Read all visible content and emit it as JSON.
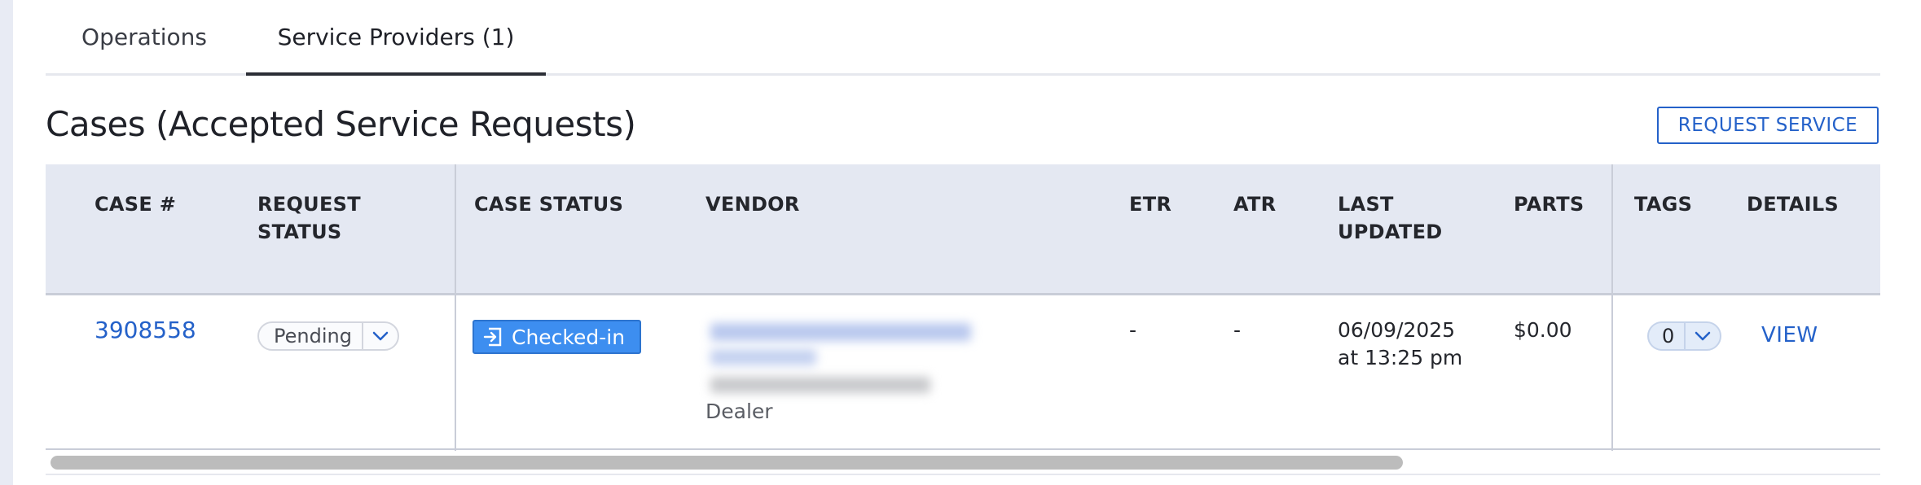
{
  "tabs": [
    {
      "label": "Operations"
    },
    {
      "label": "Service Providers (1)"
    }
  ],
  "header": {
    "title": "Cases (Accepted Service Requests)",
    "request_button": "REQUEST SERVICE"
  },
  "table": {
    "columns": {
      "case": "CASE #",
      "request_status": "REQUEST STATUS",
      "case_status": "CASE STATUS",
      "vendor": "VENDOR",
      "etr": "ETR",
      "atr": "ATR",
      "last_updated": "LAST UPDATED",
      "parts": "PARTS",
      "tags": "TAGS",
      "details": "DETAILS"
    },
    "rows": [
      {
        "case_number": "3908558",
        "request_status": "Pending",
        "case_status": "Checked-in",
        "vendor_type": "Dealer",
        "etr": "-",
        "atr": "-",
        "last_updated_date": "06/09/2025",
        "last_updated_time": "at 13:25 pm",
        "parts": "$0.00",
        "tags_count": "0",
        "details_link": "VIEW"
      }
    ]
  },
  "colors": {
    "link": "#2461c9",
    "header_bg": "#e4e8f2",
    "status_badge": "#3d8ef0",
    "tag_pill": "#e3ecf9"
  },
  "icons": [
    "chevron-down-icon",
    "check-in-icon"
  ]
}
